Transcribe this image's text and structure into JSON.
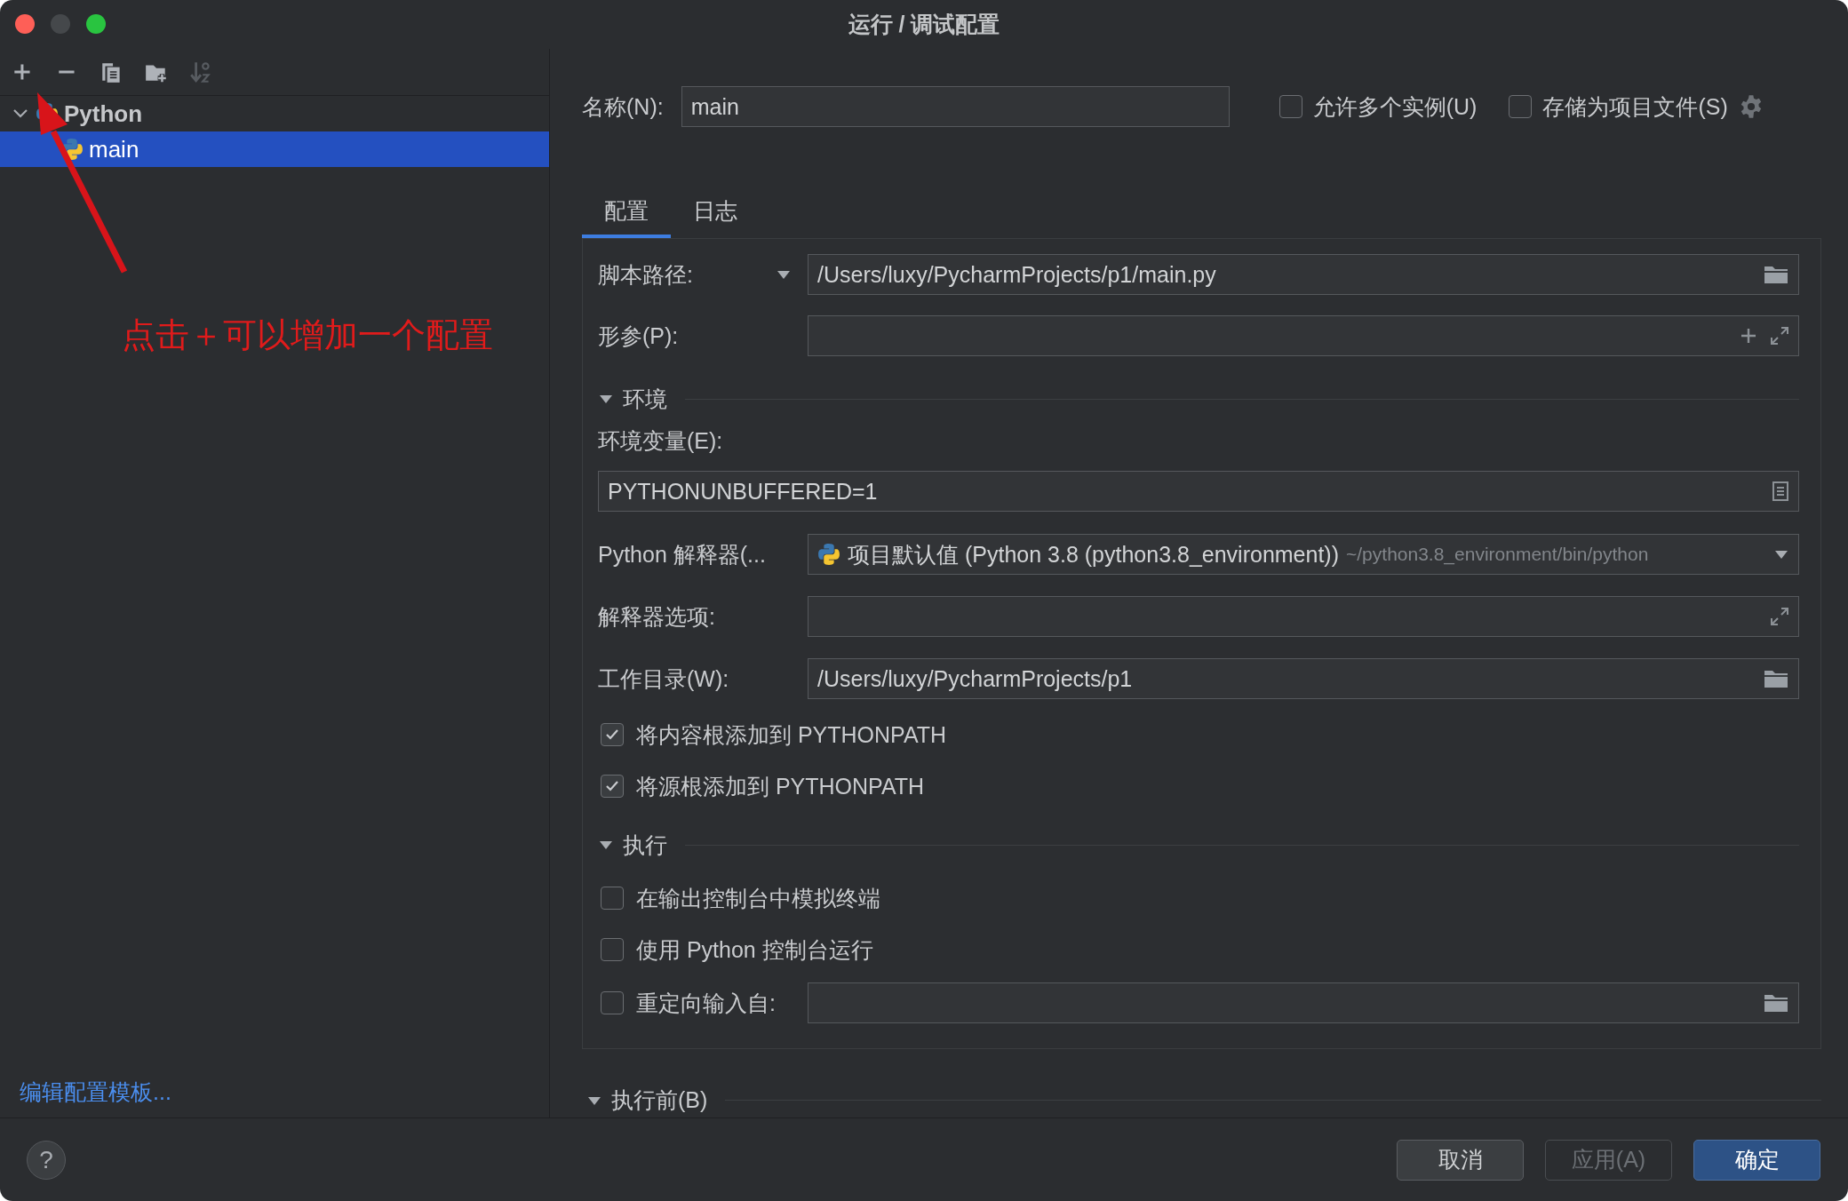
{
  "window": {
    "title": "运行 / 调试配置"
  },
  "sidebar": {
    "toolbar": [
      {
        "kind": "add",
        "disabled": false
      },
      {
        "kind": "remove",
        "disabled": false
      },
      {
        "kind": "copy",
        "disabled": false
      },
      {
        "kind": "new-folder",
        "disabled": false
      },
      {
        "kind": "sort",
        "disabled": true
      }
    ],
    "tree": [
      {
        "label": "Python",
        "expanded": true,
        "selected": false,
        "children": [
          {
            "label": "main",
            "selected": true
          }
        ]
      }
    ],
    "footer_link": "编辑配置模板..."
  },
  "annotation": {
    "text": "点击＋可以增加一个配置"
  },
  "name_field": {
    "label": "名称(N):",
    "value": "main"
  },
  "options": [
    {
      "label": "允许多个实例(U)",
      "checked": false
    },
    {
      "label": "存储为项目文件(S)",
      "checked": false
    }
  ],
  "tabs": [
    {
      "label": "配置",
      "selected": true
    },
    {
      "label": "日志",
      "selected": false
    }
  ],
  "form": [
    {
      "kind": "script",
      "label": "脚本路径:",
      "value": "/Users/luxy/PycharmProjects/p1/main.py"
    },
    {
      "kind": "args",
      "label": "形参(P):"
    },
    {
      "kind": "section",
      "label": "环境",
      "expanded": true
    },
    {
      "kind": "label",
      "label": "环境变量(E):"
    },
    {
      "kind": "env",
      "value": "PYTHONUNBUFFERED=1"
    },
    {
      "kind": "interpreter",
      "label": "Python 解释器(...",
      "value": "项目默认值 (Python 3.8 (python3.8_environment))",
      "hint": "~/python3.8_environment/bin/python"
    },
    {
      "kind": "expand",
      "label": "解释器选项:"
    },
    {
      "kind": "path",
      "label": "工作目录(W):",
      "value": "/Users/luxy/PycharmProjects/p1"
    },
    {
      "kind": "checkbox",
      "label": "将内容根添加到 PYTHONPATH",
      "checked": true
    },
    {
      "kind": "checkbox",
      "label": "将源根添加到 PYTHONPATH",
      "checked": true
    },
    {
      "kind": "section",
      "label": "执行",
      "expanded": true
    },
    {
      "kind": "checkbox",
      "label": "在输出控制台中模拟终端",
      "checked": false
    },
    {
      "kind": "checkbox",
      "label": "使用 Python 控制台运行",
      "checked": false
    },
    {
      "kind": "checkbox-path",
      "label": "重定向输入自:",
      "checked": false
    }
  ],
  "before_launch": {
    "label": "执行前(B)",
    "expanded": true
  },
  "help_button": "?",
  "buttons": [
    {
      "label": "取消",
      "kind": "normal",
      "disabled": false
    },
    {
      "label": "应用(A)",
      "kind": "normal",
      "disabled": true
    },
    {
      "label": "确定",
      "kind": "default",
      "disabled": false
    }
  ]
}
